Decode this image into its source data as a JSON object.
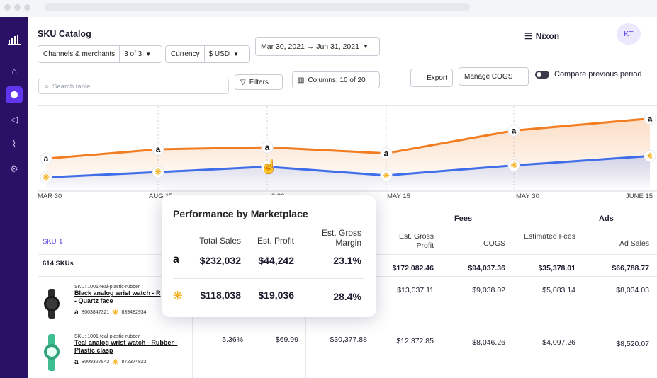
{
  "page": {
    "title": "SKU Catalog",
    "user_name": "Nixon",
    "avatar_initials": "KT"
  },
  "toolbar": {
    "channels_label": "Channels & merchants",
    "channels_value": "3 of 3",
    "currency_label": "Currency",
    "currency_value": "$ USD",
    "date_range": "Mar 30, 2021 → Jun 31, 2021",
    "search_placeholder": "Search table",
    "filters_label": "Filters",
    "columns_label": "Columns: 10 of 20",
    "export_label": "Export",
    "manage_cogs_label": "Manage COGS",
    "compare_label": "Compare previous period"
  },
  "chart_data": {
    "type": "line",
    "x": [
      "MAR 30",
      "AUG 15",
      "",
      "MAY 15",
      "MAY 30",
      "JUNE 15"
    ],
    "series": [
      {
        "marker": "amazon",
        "color": "#f07d22",
        "values": [
          0.4,
          0.54,
          0.57,
          0.48,
          0.82,
          1.0
        ]
      },
      {
        "marker": "walmart",
        "color": "#3f6ee8",
        "values": [
          0.12,
          0.2,
          0.28,
          0.15,
          0.3,
          0.44
        ]
      }
    ],
    "x_tick_labels": [
      "MAR 30",
      "AUG 15",
      "3 30",
      "MAY 15",
      "MAY 30",
      "JUNE 15"
    ],
    "y_range": [
      0,
      1.1
    ],
    "grid": "vertical-dashed"
  },
  "popup": {
    "title": "Performance by Marketplace",
    "headers": [
      "Total Sales",
      "Est. Profit",
      "Est. Gross Margin"
    ],
    "rows": [
      {
        "marketplace": "amazon",
        "total_sales": "$232,032",
        "est_profit": "$44,242",
        "margin": "23.1%"
      },
      {
        "marketplace": "walmart",
        "total_sales": "$118,038",
        "est_profit": "$19,036",
        "margin": "28.4%"
      }
    ]
  },
  "table": {
    "group_fees": "Fees",
    "group_ads": "Ads",
    "col_sku": "SKU",
    "col_gross_profit": "Est. Gross Profit",
    "col_cogs": "COGS",
    "col_est_fees": "Estimated Fees",
    "col_ad_sales": "Ad Sales",
    "summary": {
      "label": "614 SKUs",
      "gross_profit": "$172,082.46",
      "cogs": "$94,037.36",
      "est_fees": "$35,378.01",
      "ad_sales": "$66,788.77"
    },
    "rows": [
      {
        "sku": "SKU: 1001-teal-plastic-rubber",
        "name_line1": "Black analog wrist watch - R",
        "name_line2": "- Quartz face",
        "amazon_id": "B003847321",
        "walmart_id": "839482934",
        "pct": "",
        "price": "",
        "sales": "",
        "gross_profit": "$13,037.11",
        "cogs": "$9,038.02",
        "est_fees": "$5,083.14",
        "ad_sales": "$8,034.03"
      },
      {
        "sku": "SKU: 1001-teal-plastic-rubber",
        "name_line1": "Teal analog wrist watch - Rubber -",
        "name_line2": "Plastic clasp",
        "amazon_id": "B009327843",
        "walmart_id": "872374823",
        "pct": "5.36%",
        "price": "$69.99",
        "sales": "$30,377.88",
        "gross_profit": "$12,372.85",
        "cogs": "$8,046.26",
        "est_fees": "$4,097.26",
        "ad_sales": "$8,520.07"
      }
    ]
  },
  "icons": {
    "amazon_glyph": "a",
    "walmart_glyph": "✳"
  }
}
